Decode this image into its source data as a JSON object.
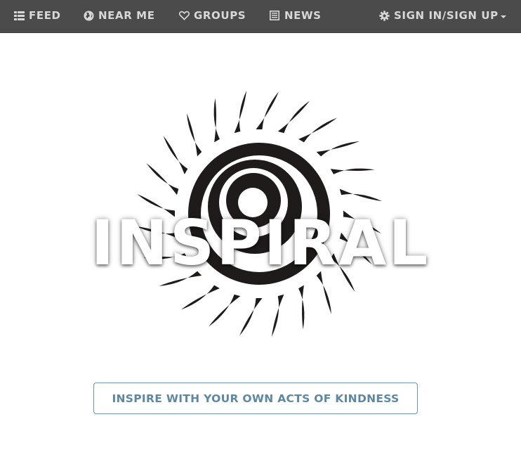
{
  "nav": {
    "feed": {
      "label": "FEED",
      "icon": "list-icon"
    },
    "near_me": {
      "label": "NEAR ME",
      "icon": "globe-icon"
    },
    "groups": {
      "label": "GROUPS",
      "icon": "heart-icon"
    },
    "news": {
      "label": "NEWS",
      "icon": "newspaper-icon"
    },
    "account": {
      "label": "SIGN IN/SIGN UP",
      "icon": "gear-icon"
    }
  },
  "hero": {
    "title": "INSPIRAL",
    "logo": "spiral-sun-logo"
  },
  "cta": {
    "label": "INSPIRE WITH YOUR OWN ACTS OF KINDNESS"
  },
  "colors": {
    "navbar_bg": "#4b4b4b",
    "nav_text": "#d8d8d8",
    "cta_text": "#5e87a3",
    "cta_border": "#6e96b1",
    "logo": "#1f1b1a"
  }
}
